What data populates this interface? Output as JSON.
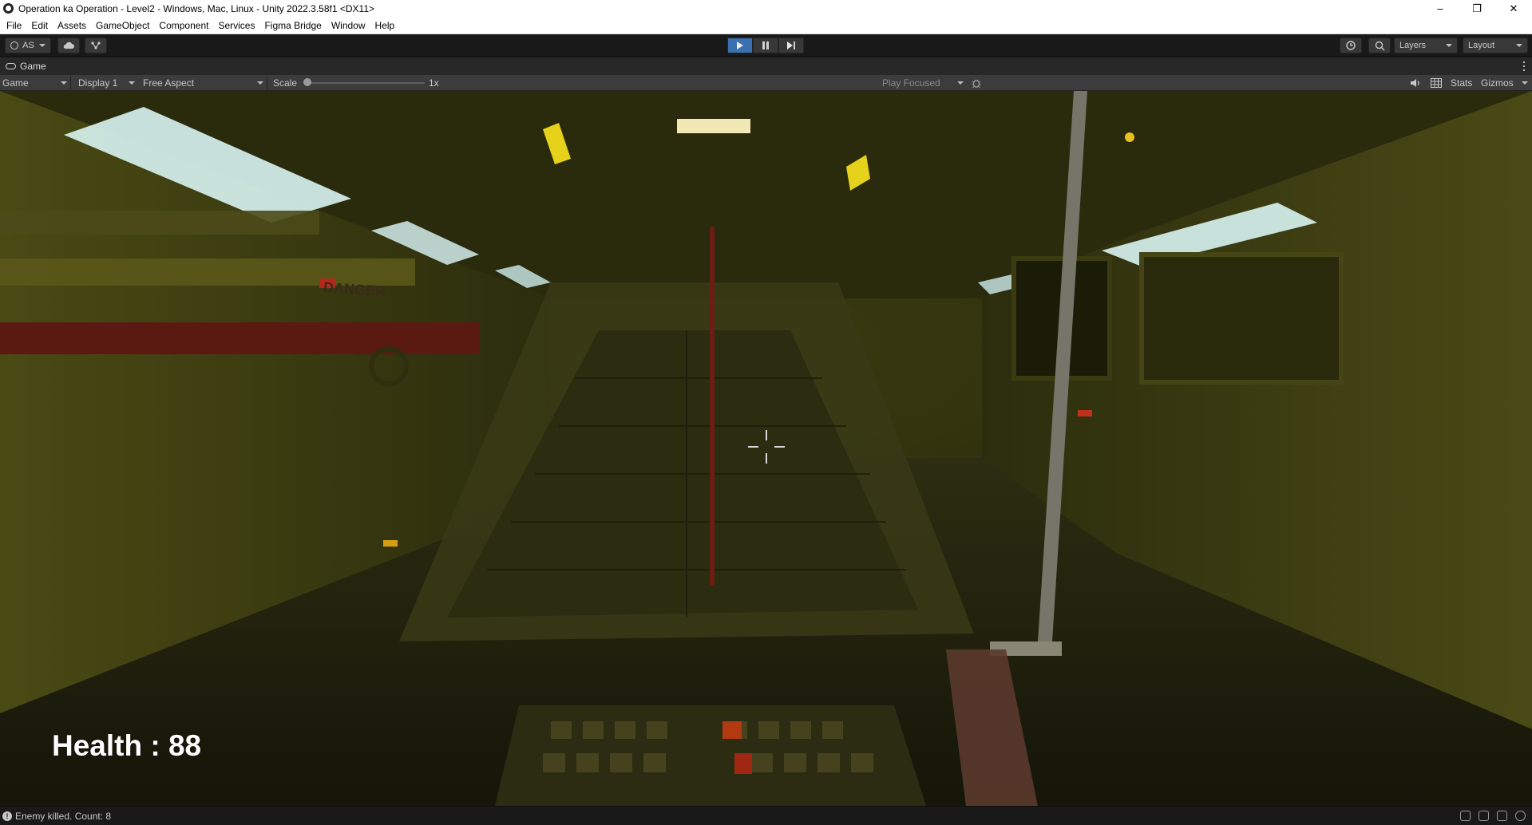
{
  "window": {
    "title": "Operation ka Operation - Level2 - Windows, Mac, Linux - Unity 2022.3.58f1 <DX11>",
    "controls": [
      "–",
      "❐",
      "✕"
    ]
  },
  "menu": [
    "File",
    "Edit",
    "Assets",
    "GameObject",
    "Component",
    "Services",
    "Figma Bridge",
    "Window",
    "Help"
  ],
  "toolbar": {
    "account_label": "AS",
    "layers_label": "Layers",
    "layout_label": "Layout",
    "play_active": true
  },
  "tab": {
    "label": "Game"
  },
  "game_toolbar": {
    "view_mode": "Game",
    "display": "Display 1",
    "aspect": "Free Aspect",
    "scale_label": "Scale",
    "scale_value": "1x",
    "play_mode": "Play Focused",
    "stats_label": "Stats",
    "gizmos_label": "Gizmos"
  },
  "hud": {
    "health_text": "Health : 88",
    "world_sign": "DANGER"
  },
  "status": {
    "message": "Enemy killed. Count: 8"
  },
  "colors": {
    "play_accent": "#3a6fb0",
    "editor_bg": "#191919",
    "scene_tint": "#6b6a14"
  }
}
